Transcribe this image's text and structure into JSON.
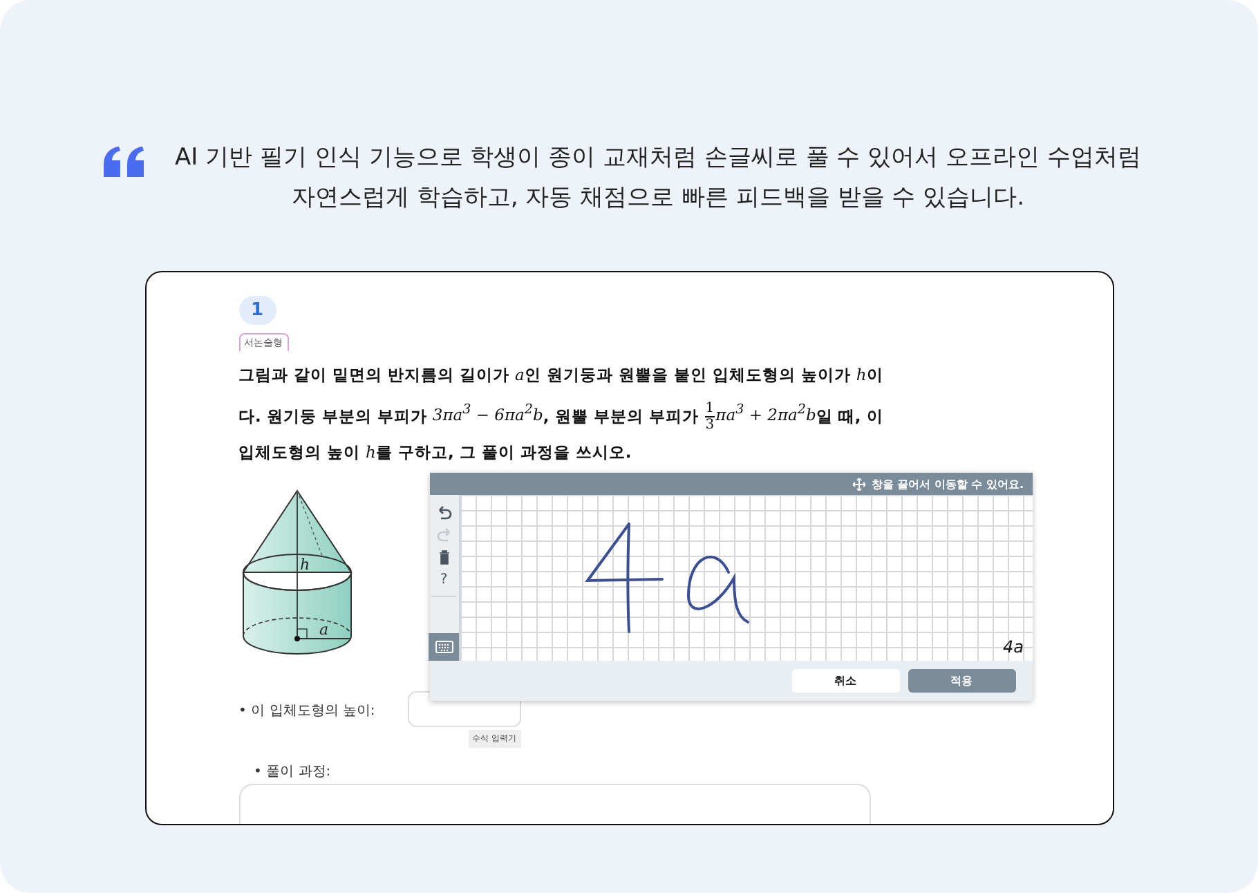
{
  "quote": {
    "lines": [
      "AI 기반 필기 인식 기능으로 학생이 종이 교재처럼 손글씨로 풀 수 있어서 오프라인 수업처럼",
      "자연스럽게 학습하고, 자동 채점으로 빠른 피드백을 받을 수 있습니다."
    ]
  },
  "question": {
    "number": "1",
    "tag": "서논술형",
    "segments": [
      {
        "kind": "text",
        "text": "그림과 같이 밑면의 반지름의 길이가 "
      },
      {
        "kind": "math",
        "text": "a"
      },
      {
        "kind": "text",
        "text": "인 원기둥과 원뿔을 붙인 입체도형의 높이가 "
      },
      {
        "kind": "math",
        "text": "h"
      },
      {
        "kind": "text",
        "text": "이다. 원기둥 부분의 부피가 "
      },
      {
        "kind": "math",
        "text": "3πa$^{3}$ − 6πa$^{2}$b"
      },
      {
        "kind": "text",
        "text": ", 원뿔 부분의 부피가 "
      },
      {
        "kind": "fraction",
        "numerator": "1",
        "denominator": "3"
      },
      {
        "kind": "math",
        "text": "πa$^{3}$ + 2πa$^{2}$b"
      },
      {
        "kind": "text",
        "text": "일 때, 이 입체도형의 높이 "
      },
      {
        "kind": "math",
        "text": "h"
      },
      {
        "kind": "text",
        "text": "를 구하고, 그 풀이 과정을 쓰시오."
      }
    ],
    "figure": {
      "height_label": "h",
      "radius_label": "a"
    }
  },
  "answer": {
    "label": "• 이 입체도형의 높이:",
    "editor_tag": "수식 입력기"
  },
  "solution": {
    "label": "• 풀이 과정:"
  },
  "handwriting_panel": {
    "hint": "창을 끌어서 이동할 수 있어요.",
    "tools": [
      {
        "kind": "undo",
        "disabled": false
      },
      {
        "kind": "redo",
        "disabled": true
      },
      {
        "kind": "delete",
        "disabled": false
      },
      {
        "kind": "help",
        "label": "?",
        "disabled": false
      },
      {
        "kind": "keyboard",
        "disabled": false
      }
    ],
    "recognized": "4a",
    "buttons": [
      {
        "label": "취소",
        "kind": "cancel"
      },
      {
        "label": "적용",
        "kind": "apply"
      }
    ]
  }
}
